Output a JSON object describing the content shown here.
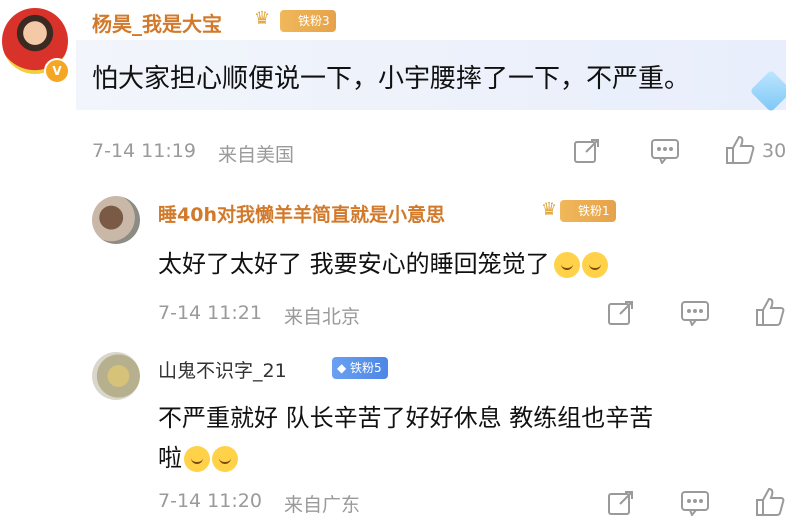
{
  "comments": [
    {
      "name": "杨昊_我是大宝",
      "fan_badge": "铁粉3",
      "text": "怕大家担心顺便说一下，小宇腰摔了一下，不严重。",
      "time": "7-14 11:19",
      "location": "来自美国",
      "likes": "30"
    },
    {
      "name": "睡40h对我懒羊羊简直就是小意思",
      "fan_badge": "铁粉1",
      "text": "太好了太好了 我要安心的睡回笼觉了",
      "time": "7-14 11:21",
      "location": "来自北京"
    },
    {
      "name": "山鬼不识字_21",
      "fan_badge": "铁粉5",
      "text_line1": "不严重就好 队长辛苦了好好休息 教练组也辛苦",
      "text_line2": "啦",
      "time": "7-14 11:20",
      "location": "来自广东"
    }
  ],
  "icons": [
    "share-icon",
    "comment-icon",
    "like-icon",
    "crown-icon",
    "verified-badge-icon",
    "crying-emoji",
    "pleading-emoji"
  ],
  "colors": {
    "name_accent": "#d27a2c",
    "meta_gray": "#9a9a9a",
    "highlight_bg": "#eef2fb"
  }
}
